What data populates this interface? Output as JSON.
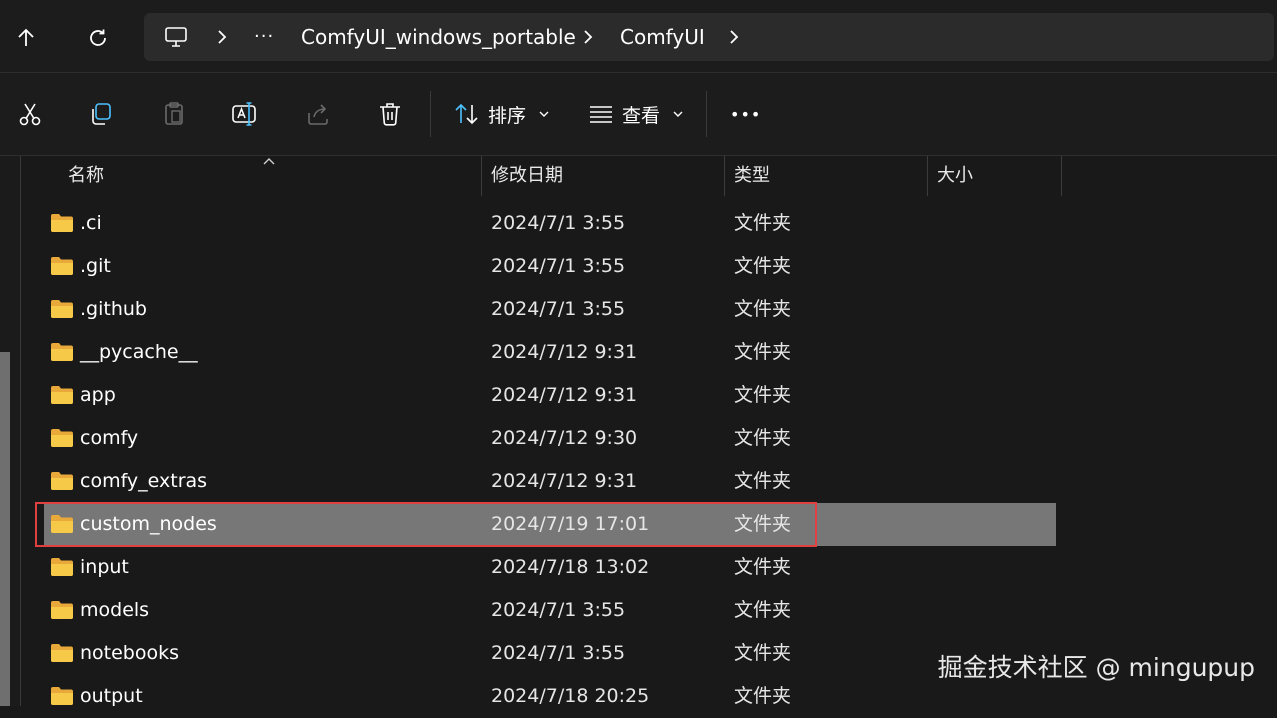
{
  "address_bar": {
    "ellipsis": "···",
    "crumbs": [
      "ComfyUI_windows_portable",
      "ComfyUI"
    ]
  },
  "toolbar": {
    "sort_label": "排序",
    "view_label": "查看",
    "more_label": "•••"
  },
  "columns": {
    "name": "名称",
    "date": "修改日期",
    "type": "类型",
    "size": "大小"
  },
  "files": [
    {
      "name": ".ci",
      "date": "2024/7/1 3:55",
      "type": "文件夹"
    },
    {
      "name": ".git",
      "date": "2024/7/1 3:55",
      "type": "文件夹"
    },
    {
      "name": ".github",
      "date": "2024/7/1 3:55",
      "type": "文件夹"
    },
    {
      "name": "__pycache__",
      "date": "2024/7/12 9:31",
      "type": "文件夹"
    },
    {
      "name": "app",
      "date": "2024/7/12 9:31",
      "type": "文件夹"
    },
    {
      "name": "comfy",
      "date": "2024/7/12 9:30",
      "type": "文件夹"
    },
    {
      "name": "comfy_extras",
      "date": "2024/7/12 9:31",
      "type": "文件夹"
    },
    {
      "name": "custom_nodes",
      "date": "2024/7/19 17:01",
      "type": "文件夹"
    },
    {
      "name": "input",
      "date": "2024/7/18 13:02",
      "type": "文件夹"
    },
    {
      "name": "models",
      "date": "2024/7/1 3:55",
      "type": "文件夹"
    },
    {
      "name": "notebooks",
      "date": "2024/7/1 3:55",
      "type": "文件夹"
    },
    {
      "name": "output",
      "date": "2024/7/18 20:25",
      "type": "文件夹"
    }
  ],
  "watermark": "掘金技术社区 @ mingupup",
  "colors": {
    "folder": "#f7c948",
    "selection": "#777777",
    "highlight": "#e0403f"
  }
}
